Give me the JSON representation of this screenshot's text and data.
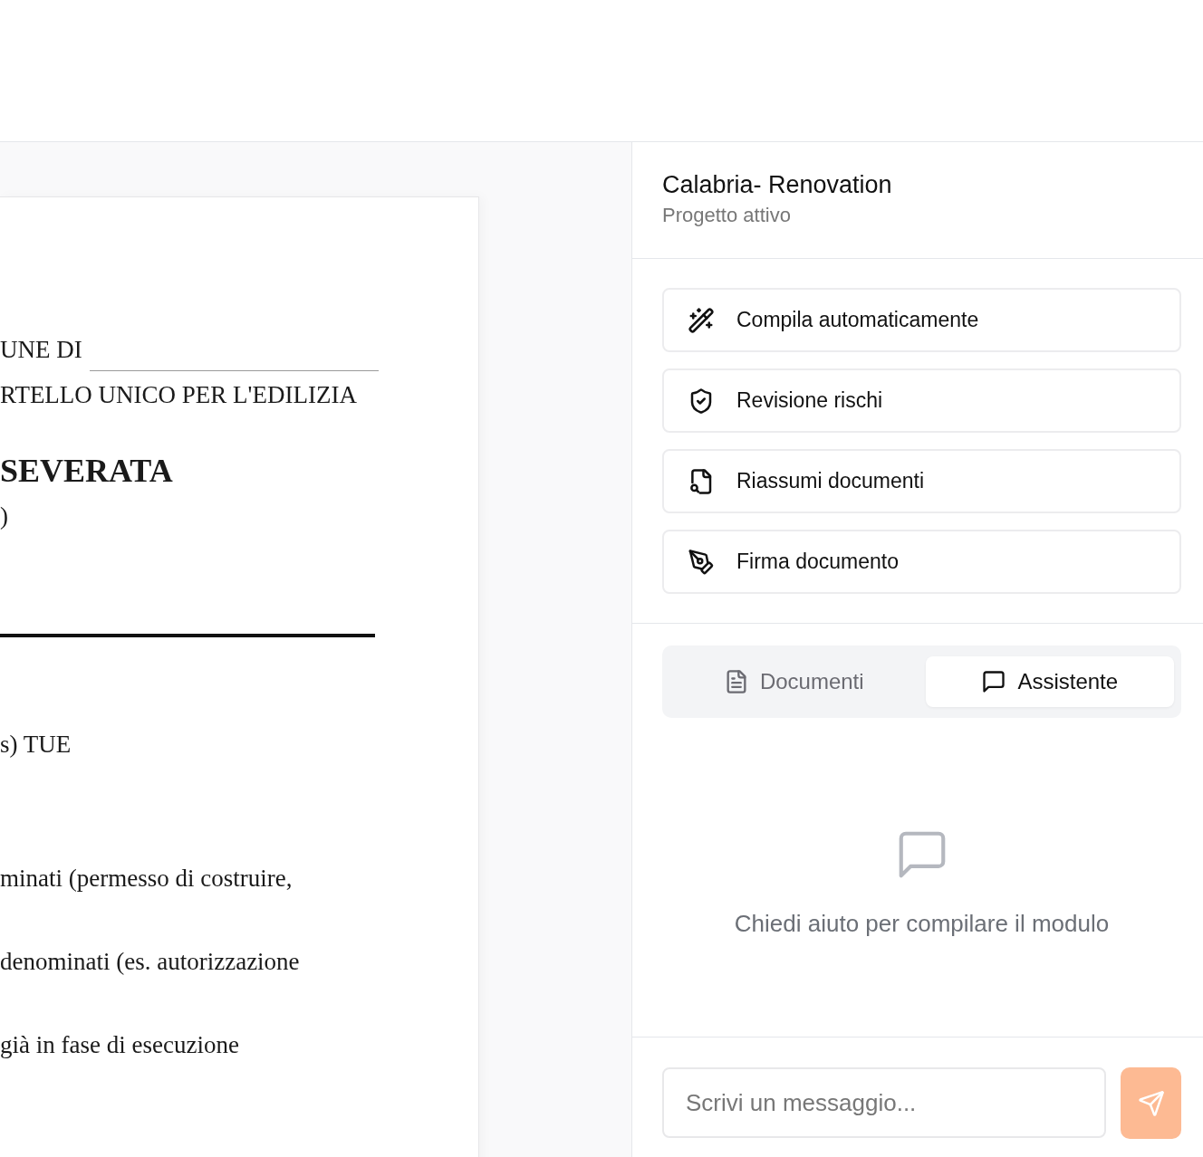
{
  "document": {
    "lines": [
      {
        "kind": "field",
        "text": "UNE DI"
      },
      {
        "kind": "text",
        "text": "RTELLO UNICO PER L'EDILIZIA"
      },
      {
        "kind": "heading",
        "text": "SEVERATA"
      },
      {
        "kind": "text",
        "text": ")"
      },
      {
        "kind": "rule"
      },
      {
        "kind": "text",
        "text": "s) TUE"
      },
      {
        "kind": "text",
        "text": "minati (permesso di costruire,"
      },
      {
        "kind": "text",
        "text": "denominati (es. autorizzazione"
      },
      {
        "kind": "text",
        "text": "già in fase di esecuzione"
      }
    ]
  },
  "project": {
    "title": "Calabria- Renovation",
    "subtitle": "Progetto attivo"
  },
  "actions": [
    {
      "label": "Compila automaticamente",
      "kind": "wand"
    },
    {
      "label": "Revisione rischi",
      "kind": "shield"
    },
    {
      "label": "Riassumi documenti",
      "kind": "search"
    },
    {
      "label": "Firma documento",
      "kind": "pen"
    }
  ],
  "tabs": [
    {
      "label": "Documenti",
      "kind": "document",
      "selected": false
    },
    {
      "label": "Assistente",
      "kind": "chat",
      "selected": true
    }
  ],
  "empty_state": {
    "message": "Chiedi aiuto per compilare il modulo"
  },
  "composer": {
    "placeholder": "Scrivi un messaggio..."
  }
}
